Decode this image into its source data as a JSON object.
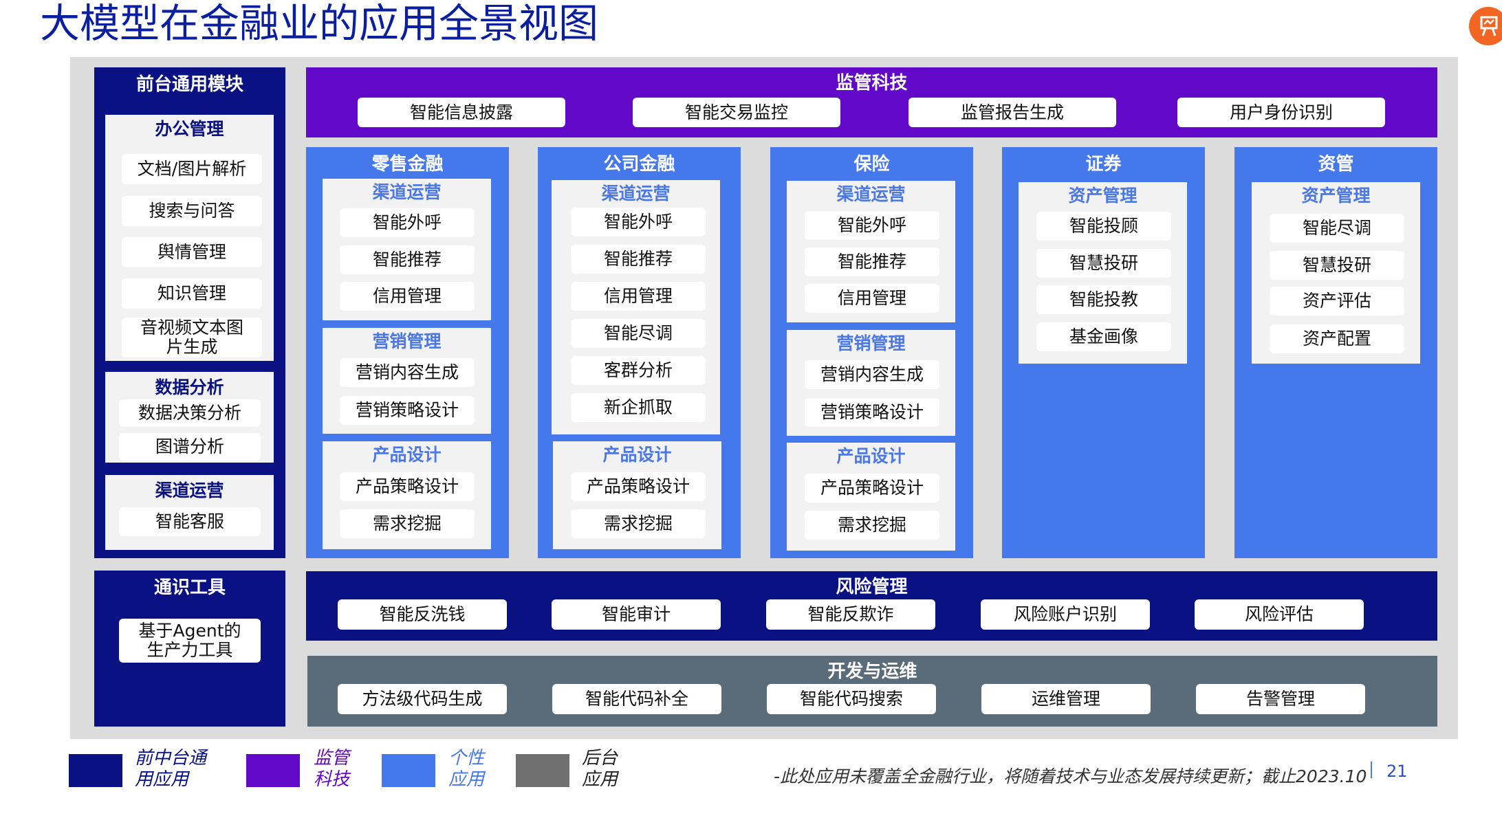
{
  "title": "大模型在金融业的应用全景视图",
  "front": {
    "header": "前台通用模块",
    "office": {
      "title": "办公管理",
      "items": [
        "文档/图片解析",
        "搜索与问答",
        "舆情管理",
        "知识管理",
        "音视频文本图片生成"
      ]
    },
    "data": {
      "title": "数据分析",
      "items": [
        "数据决策分析",
        "图谱分析"
      ]
    },
    "channel": {
      "title": "渠道运营",
      "items": [
        "智能客服"
      ]
    }
  },
  "knowledge": {
    "header": "通识工具",
    "items": [
      "基于Agent的生产力工具"
    ]
  },
  "regtech": {
    "header": "监管科技",
    "items": [
      "智能信息披露",
      "智能交易监控",
      "监管报告生成",
      "用户身份识别"
    ]
  },
  "retail": {
    "header": "零售金融",
    "groups": [
      {
        "title": "渠道运营",
        "items": [
          "智能外呼",
          "智能推荐",
          "信用管理"
        ]
      },
      {
        "title": "营销管理",
        "items": [
          "营销内容生成",
          "营销策略设计"
        ]
      },
      {
        "title": "产品设计",
        "items": [
          "产品策略设计",
          "需求挖掘"
        ]
      }
    ]
  },
  "corporate": {
    "header": "公司金融",
    "groups": [
      {
        "title": "渠道运营",
        "items": [
          "智能外呼",
          "智能推荐",
          "信用管理",
          "智能尽调",
          "客群分析",
          "新企抓取"
        ]
      },
      {
        "title": "产品设计",
        "items": [
          "产品策略设计",
          "需求挖掘"
        ]
      }
    ]
  },
  "insurance": {
    "header": "保险",
    "groups": [
      {
        "title": "渠道运营",
        "items": [
          "智能外呼",
          "智能推荐",
          "信用管理"
        ]
      },
      {
        "title": "营销管理",
        "items": [
          "营销内容生成",
          "营销策略设计"
        ]
      },
      {
        "title": "产品设计",
        "items": [
          "产品策略设计",
          "需求挖掘"
        ]
      }
    ]
  },
  "securities": {
    "header": "证券",
    "groups": [
      {
        "title": "资产管理",
        "items": [
          "智能投顾",
          "智慧投研",
          "智能投教",
          "基金画像"
        ]
      }
    ]
  },
  "assetmgmt": {
    "header": "资管",
    "groups": [
      {
        "title": "资产管理",
        "items": [
          "智能尽调",
          "智慧投研",
          "资产评估",
          "资产配置"
        ]
      }
    ]
  },
  "risk": {
    "header": "风险管理",
    "items": [
      "智能反洗钱",
      "智能审计",
      "智能反欺诈",
      "风险账户识别",
      "风险评估"
    ]
  },
  "devops": {
    "header": "开发与运维",
    "items": [
      "方法级代码生成",
      "智能代码补全",
      "智能代码搜索",
      "运维管理",
      "告警管理"
    ]
  },
  "legend": [
    {
      "label": "前中台通用应用",
      "color": "#0a1182"
    },
    {
      "label": "监管科技",
      "color": "#6208c8"
    },
    {
      "label": "个性应用",
      "color": "#4578ea"
    },
    {
      "label": "后台应用",
      "color": "#707070"
    }
  ],
  "footnote": "-此处应用未覆盖全金融行业，将随着技术与业态发展持续更新；截止2023.10",
  "page_number": "21",
  "corner_icon": "presentation-icon"
}
